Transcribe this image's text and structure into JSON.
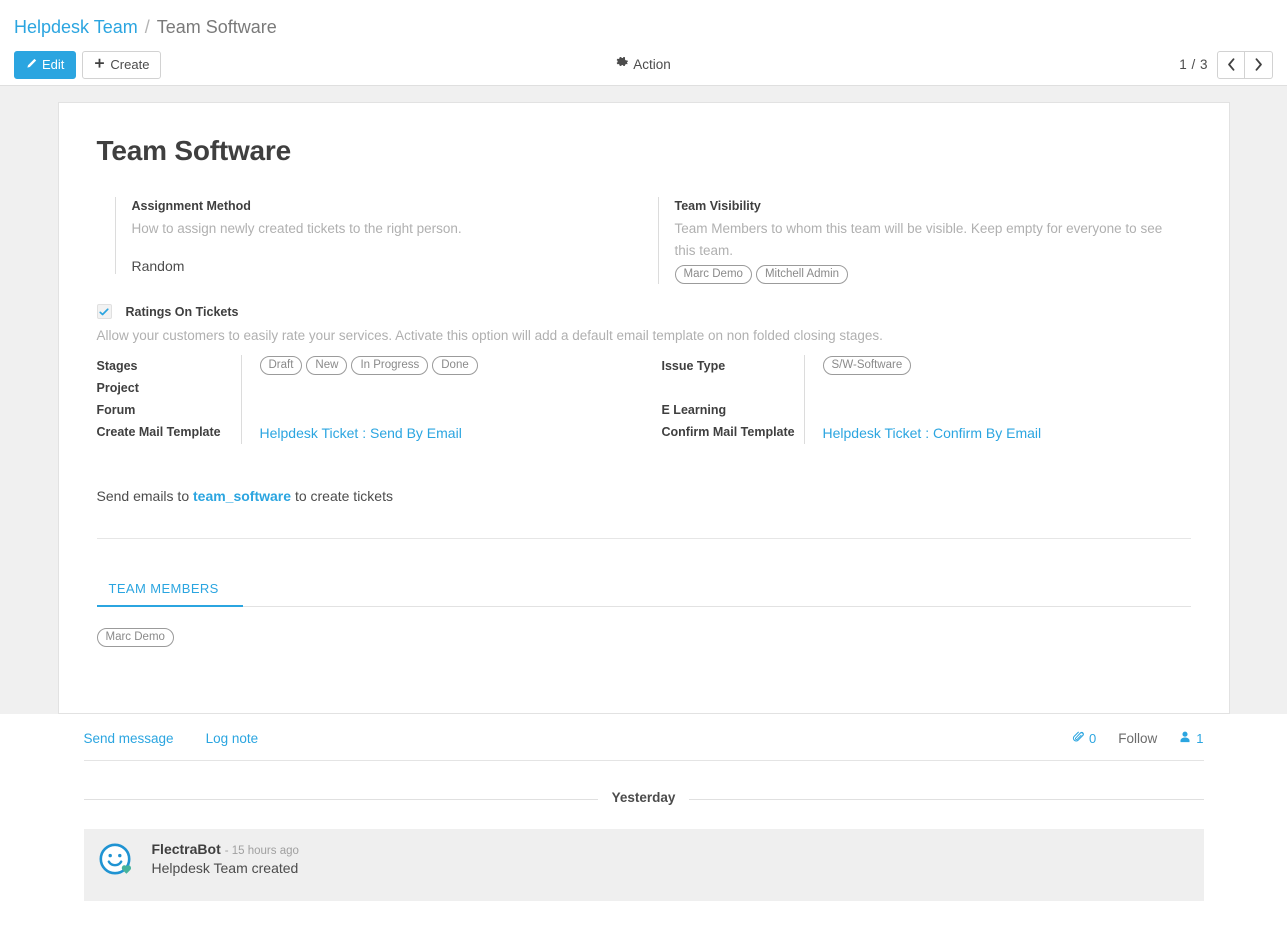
{
  "breadcrumb": {
    "parent": "Helpdesk Team",
    "separator": "/",
    "current": "Team Software"
  },
  "control_panel": {
    "edit_label": "Edit",
    "create_label": "Create",
    "action_label": "Action",
    "pager_count": "1 / 3",
    "prev_icon": "chevron-left-icon",
    "next_icon": "chevron-right-icon"
  },
  "record": {
    "title": "Team Software",
    "assignment": {
      "label": "Assignment Method",
      "help": "How to assign newly created tickets to the right person.",
      "value": "Random"
    },
    "visibility": {
      "label": "Team Visibility",
      "help": "Team Members to whom this team will be visible. Keep empty for everyone to see this team.",
      "tags": [
        "Marc Demo",
        "Mitchell Admin"
      ]
    },
    "ratings": {
      "label": "Ratings On Tickets",
      "checked": true,
      "help": "Allow your customers to easily rate your services. Activate this option will add a default email template on non folded closing stages."
    },
    "left_fields": {
      "labels": [
        "Stages",
        "Project",
        "Forum",
        "Create Mail Template"
      ],
      "stages_tags": [
        "Draft",
        "New",
        "In Progress",
        "Done"
      ],
      "project_value": "",
      "forum_value": "",
      "create_mail_template_value": "Helpdesk Ticket : Send By Email"
    },
    "right_fields": {
      "labels": [
        "Issue Type",
        "",
        "E Learning",
        "Confirm Mail Template"
      ],
      "issue_type_tags": [
        "S/W-Software"
      ],
      "elearning_value": "",
      "confirm_mail_template_value": "Helpdesk Ticket : Confirm By Email"
    },
    "alias": {
      "prefix": "Send emails to",
      "alias_name": "team_software",
      "suffix": "to create tickets"
    },
    "notebook": {
      "tabs": [
        {
          "label": "TEAM MEMBERS"
        }
      ],
      "members": [
        "Marc Demo"
      ]
    }
  },
  "chatter": {
    "send_message": "Send message",
    "log_note": "Log note",
    "attachment_icon": "paperclip-icon",
    "attachment_count": "0",
    "follow_label": "Follow",
    "follower_icon": "user-icon",
    "follower_count": "1",
    "day_separator": "Yesterday",
    "messages": [
      {
        "author": "FlectraBot",
        "time": "- 15 hours ago",
        "body": "Helpdesk Team created",
        "avatar_icon": "smiley-bot-avatar-icon"
      }
    ]
  },
  "colors": {
    "accent": "#2ba5e0",
    "page_bg": "#f0f0f0",
    "text": "#4c4c4c",
    "muted": "#b0b0b0",
    "avatar_blue": "#1f93d2",
    "avatar_heart": "#45b39d"
  }
}
